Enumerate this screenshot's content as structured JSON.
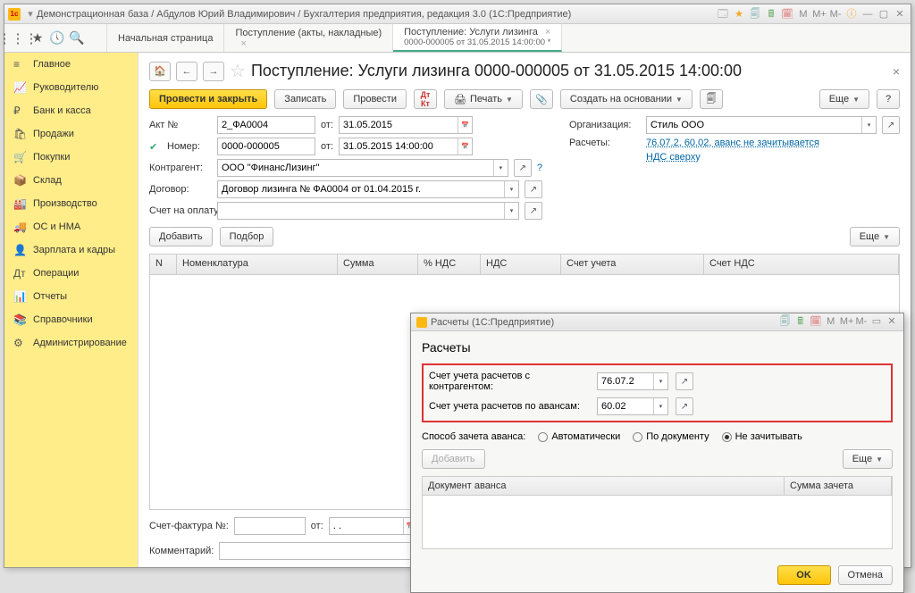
{
  "titlebar": "Демонстрационная база / Абдулов Юрий Владимирович / Бухгалтерия предприятия, редакция 3.0  (1С:Предприятие)",
  "tabs": [
    {
      "label": "Начальная страница"
    },
    {
      "label": "Поступление (акты, накладные)"
    },
    {
      "label": "Поступление: Услуги лизинга",
      "sub": "0000-000005 от 31.05.2015 14:00:00 *"
    }
  ],
  "sidebar": [
    {
      "icon": "≡",
      "label": "Главное"
    },
    {
      "icon": "📈",
      "label": "Руководителю"
    },
    {
      "icon": "₽",
      "label": "Банк и касса"
    },
    {
      "icon": "🛍",
      "label": "Продажи"
    },
    {
      "icon": "🛒",
      "label": "Покупки"
    },
    {
      "icon": "📦",
      "label": "Склад"
    },
    {
      "icon": "🏭",
      "label": "Производство"
    },
    {
      "icon": "🚚",
      "label": "ОС и НМА"
    },
    {
      "icon": "👤",
      "label": "Зарплата и кадры"
    },
    {
      "icon": "Дт",
      "label": "Операции"
    },
    {
      "icon": "📊",
      "label": "Отчеты"
    },
    {
      "icon": "📚",
      "label": "Справочники"
    },
    {
      "icon": "⚙",
      "label": "Администрирование"
    }
  ],
  "page": {
    "title": "Поступление: Услуги лизинга 0000-000005 от 31.05.2015 14:00:00",
    "buttons": {
      "main": "Провести и закрыть",
      "save": "Записать",
      "post": "Провести",
      "print": "Печать",
      "createbased": "Создать на основании",
      "more": "Еще"
    },
    "fields": {
      "act_no_lbl": "Акт №",
      "act_no": "2_ФА0004",
      "from_lbl": "от:",
      "act_date": "31.05.2015",
      "number_lbl": "Номер:",
      "number": "0000-000005",
      "number_date": "31.05.2015 14:00:00",
      "counterparty_lbl": "Контрагент:",
      "counterparty": "ООО \"ФинансЛизинг\"",
      "contract_lbl": "Договор:",
      "contract": "Договор лизинга № ФА0004 от 01.04.2015 г.",
      "invoice_lbl": "Счет на оплату:",
      "invoice": "",
      "org_lbl": "Организация:",
      "org": "Стиль ООО",
      "calc_lbl": "Расчеты:",
      "calc_link": "76.07.2, 60.02, аванс не зачитывается",
      "vat_link": "НДС сверху",
      "add": "Добавить",
      "select": "Подбор"
    },
    "table_cols": [
      "N",
      "Номенклатура",
      "Сумма",
      "% НДС",
      "НДС",
      "Счет учета",
      "Счет НДС"
    ],
    "footer": {
      "sf_lbl": "Счет-фактура №:",
      "sf_from": "от:",
      "comment_lbl": "Комментарий:"
    }
  },
  "modal": {
    "wintitle": "Расчеты  (1С:Предприятие)",
    "title": "Расчеты",
    "fields": {
      "acc1_lbl": "Счет учета расчетов с контрагентом:",
      "acc1": "76.07.2",
      "acc2_lbl": "Счет учета расчетов по авансам:",
      "acc2": "60.02"
    },
    "advance": {
      "lbl": "Способ зачета аванса:",
      "opt1": "Автоматически",
      "opt2": "По документу",
      "opt3": "Не зачитывать"
    },
    "add": "Добавить",
    "more": "Еще",
    "cols": [
      "Документ аванса",
      "Сумма зачета"
    ],
    "ok": "OK",
    "cancel": "Отмена"
  }
}
